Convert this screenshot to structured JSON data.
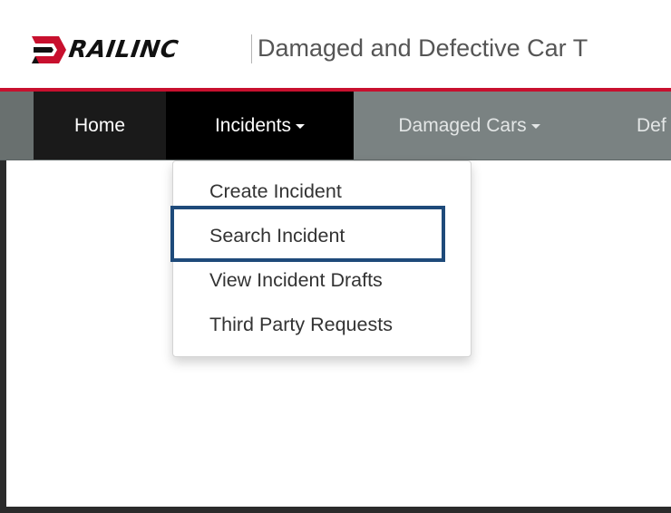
{
  "header": {
    "logo_text": "RAILINC",
    "app_title": "Damaged and Defective Car T"
  },
  "navbar": {
    "items": [
      {
        "label": "Home"
      },
      {
        "label": "Incidents"
      },
      {
        "label": "Damaged Cars"
      },
      {
        "label": "Def"
      }
    ]
  },
  "dropdown": {
    "items": [
      {
        "label": "Create Incident"
      },
      {
        "label": "Search Incident"
      },
      {
        "label": "View Incident Drafts"
      },
      {
        "label": "Third Party Requests"
      }
    ]
  },
  "colors": {
    "brand_red": "#c8102e",
    "nav_bg": "#7a8282",
    "nav_active": "#000000",
    "highlight_border": "#1e4a7a"
  },
  "icons": {
    "logo_mark": "railinc-chevron-logo",
    "dropdown_caret": "caret-down-icon"
  }
}
